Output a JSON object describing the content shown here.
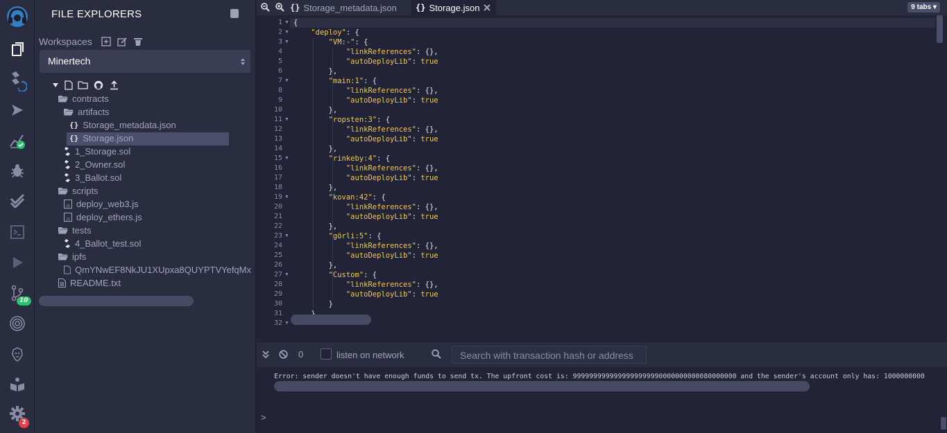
{
  "side_panel": {
    "title": "FILE EXPLORERS",
    "workspaces_label": "Workspaces",
    "workspace_selected": "Minertech",
    "tree": [
      {
        "label": "contracts",
        "type": "folder"
      },
      {
        "label": "artifacts",
        "type": "folder"
      },
      {
        "label": "Storage_metadata.json",
        "type": "json"
      },
      {
        "label": "Storage.json",
        "type": "json",
        "selected": true
      },
      {
        "label": "1_Storage.sol",
        "type": "sol"
      },
      {
        "label": "2_Owner.sol",
        "type": "sol"
      },
      {
        "label": "3_Ballot.sol",
        "type": "sol"
      },
      {
        "label": "scripts",
        "type": "folder"
      },
      {
        "label": "deploy_web3.js",
        "type": "js"
      },
      {
        "label": "deploy_ethers.js",
        "type": "js"
      },
      {
        "label": "tests",
        "type": "folder"
      },
      {
        "label": "4_Ballot_test.sol",
        "type": "sol"
      },
      {
        "label": "ipfs",
        "type": "folder"
      },
      {
        "label": "QmYNwEF8NkJU1XUpxa8QUYPTVYefqMx",
        "type": "file"
      },
      {
        "label": "README.txt",
        "type": "txt"
      }
    ]
  },
  "rail": {
    "icons": [
      "remix-logo-icon",
      "file-explorer-icon",
      "solidity-compiler-icon",
      "deploy-run-icon",
      "analysis-icon",
      "debugger-icon",
      "unit-test-icon",
      "terminal-plugin-icon",
      "run-script-icon",
      "git-icon",
      "plugin-circle-icon",
      "lion-plugin-icon",
      "learneth-icon",
      "settings-icon"
    ],
    "git_badge": "10",
    "settings_badge": "2"
  },
  "tabs": {
    "items": [
      {
        "label": "Storage_metadata.json",
        "active": false
      },
      {
        "label": "Storage.json",
        "active": true
      }
    ],
    "count_label": "9 tabs"
  },
  "editor": {
    "lines": [
      {
        "n": "1",
        "text": "{",
        "fold": true
      },
      {
        "n": "2",
        "text": "    \"deploy\": {",
        "fold": true
      },
      {
        "n": "3",
        "text": "        \"VM:-\": {",
        "fold": true
      },
      {
        "n": "4",
        "text": "            \"linkReferences\": {},",
        "fold": false
      },
      {
        "n": "5",
        "text": "            \"autoDeployLib\": true",
        "fold": false
      },
      {
        "n": "6",
        "text": "        },",
        "fold": false
      },
      {
        "n": "7",
        "text": "        \"main:1\": {",
        "fold": true
      },
      {
        "n": "8",
        "text": "            \"linkReferences\": {},",
        "fold": false
      },
      {
        "n": "9",
        "text": "            \"autoDeployLib\": true",
        "fold": false
      },
      {
        "n": "10",
        "text": "        },",
        "fold": false
      },
      {
        "n": "11",
        "text": "        \"ropsten:3\": {",
        "fold": true
      },
      {
        "n": "12",
        "text": "            \"linkReferences\": {},",
        "fold": false
      },
      {
        "n": "13",
        "text": "            \"autoDeployLib\": true",
        "fold": false
      },
      {
        "n": "14",
        "text": "        },",
        "fold": false
      },
      {
        "n": "15",
        "text": "        \"rinkeby:4\": {",
        "fold": true
      },
      {
        "n": "16",
        "text": "            \"linkReferences\": {},",
        "fold": false
      },
      {
        "n": "17",
        "text": "            \"autoDeployLib\": true",
        "fold": false
      },
      {
        "n": "18",
        "text": "        },",
        "fold": false
      },
      {
        "n": "19",
        "text": "        \"kovan:42\": {",
        "fold": true
      },
      {
        "n": "20",
        "text": "            \"linkReferences\": {},",
        "fold": false
      },
      {
        "n": "21",
        "text": "            \"autoDeployLib\": true",
        "fold": false
      },
      {
        "n": "22",
        "text": "        },",
        "fold": false
      },
      {
        "n": "23",
        "text": "        \"görli:5\": {",
        "fold": true
      },
      {
        "n": "24",
        "text": "            \"linkReferences\": {},",
        "fold": false
      },
      {
        "n": "25",
        "text": "            \"autoDeployLib\": true",
        "fold": false
      },
      {
        "n": "26",
        "text": "        },",
        "fold": false
      },
      {
        "n": "27",
        "text": "        \"Custom\": {",
        "fold": true
      },
      {
        "n": "28",
        "text": "            \"linkReferences\": {},",
        "fold": false
      },
      {
        "n": "29",
        "text": "            \"autoDeployLib\": true",
        "fold": false
      },
      {
        "n": "30",
        "text": "        }",
        "fold": false
      },
      {
        "n": "31",
        "text": "    },",
        "fold": false
      },
      {
        "n": "32",
        "text": "",
        "fold": true
      }
    ]
  },
  "terminal": {
    "count": "0",
    "listen_label": "listen on network",
    "search_placeholder": "Search with transaction hash or address",
    "message": "Error: sender doesn't have enough funds to send tx. The upfront cost is: 9999999999999999999990000000000080000000 and the sender's account only has: 1000000000",
    "prompt": ">"
  },
  "colors": {
    "background": "#222336",
    "panel": "#2a2c3f",
    "json_key": "#f0c95b",
    "badge_green": "#2fbf71",
    "badge_red": "#e83e4a"
  }
}
